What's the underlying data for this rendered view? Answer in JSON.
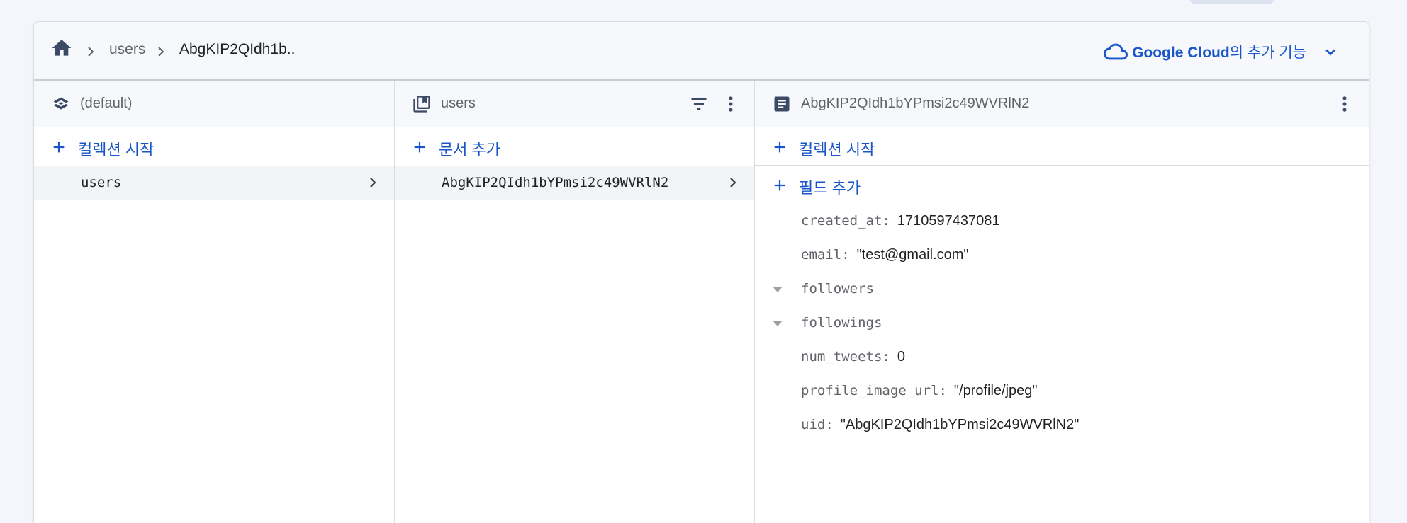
{
  "breadcrumb": {
    "items": [
      "users",
      "AbgKIP2QIdh1b.."
    ]
  },
  "gcloud": {
    "brand": "Google Cloud",
    "suffix": "의 추가 기능"
  },
  "columns": {
    "root": {
      "title": "(default)",
      "action_label": "컬렉션 시작",
      "items": [
        "users"
      ]
    },
    "collection": {
      "title": "users",
      "action_label": "문서 추가",
      "items": [
        "AbgKIP2QIdh1bYPmsi2c49WVRlN2"
      ]
    },
    "document": {
      "title": "AbgKIP2QIdh1bYPmsi2c49WVRlN2",
      "start_collection_label": "컬렉션 시작",
      "add_field_label": "필드 추가",
      "fields": [
        {
          "name": "created_at:",
          "value": "1710597437081"
        },
        {
          "name": "email:",
          "value": "\"test@gmail.com\""
        },
        {
          "name": "followers",
          "value": ""
        },
        {
          "name": "followings",
          "value": ""
        },
        {
          "name": "num_tweets:",
          "value": "0"
        },
        {
          "name": "profile_image_url:",
          "value": "\"/profile/jpeg\""
        },
        {
          "name": "uid:",
          "value": "\"AbgKIP2QIdh1bYPmsi2c49WVRlN2\""
        }
      ]
    }
  },
  "colors": {
    "accent": "#1a56c9",
    "icon": "#3c4a66",
    "background": "#f4f6fb"
  }
}
